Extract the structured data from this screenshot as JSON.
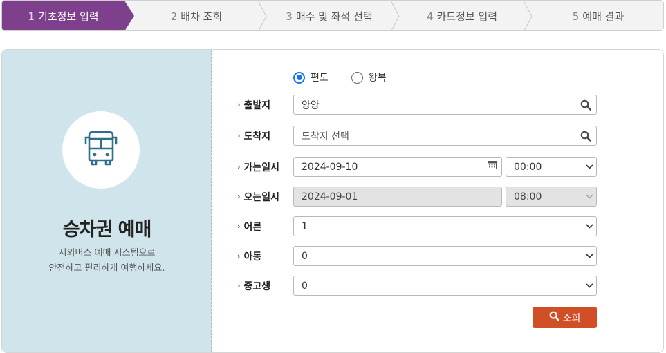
{
  "steps": [
    {
      "num": "1",
      "label": "기초정보 입력",
      "active": true
    },
    {
      "num": "2",
      "label": "배차 조회"
    },
    {
      "num": "3",
      "label": "매수 및 좌석 선택"
    },
    {
      "num": "4",
      "label": "카드정보 입력"
    },
    {
      "num": "5",
      "label": "예매 결과"
    }
  ],
  "sidebar": {
    "icon": "bus-icon",
    "title": "승차권 예매",
    "desc_line1": "시외버스 예매 시스템으로",
    "desc_line2": "안전하고 편리하게 여행하세요."
  },
  "trip_type": {
    "one_way": "편도",
    "round_trip": "왕복",
    "selected": "one_way"
  },
  "form": {
    "departure": {
      "label": "출발지",
      "value": "양양"
    },
    "arrival": {
      "label": "도착지",
      "placeholder": "도착지 선택"
    },
    "depart_date": {
      "label": "가는일시",
      "date": "2024-09-10",
      "time": "00:00"
    },
    "return_date": {
      "label": "오는일시",
      "date": "2024-09-01",
      "time": "08:00"
    },
    "adult": {
      "label": "어른",
      "value": "1"
    },
    "child": {
      "label": "아동",
      "value": "0"
    },
    "student": {
      "label": "중고생",
      "value": "0"
    }
  },
  "search_button": "조회",
  "colors": {
    "active_step": "#7e3f8d",
    "sidebar_bg": "#cfe4eb",
    "accent": "#d14f27",
    "label_marker": "#c2371b",
    "icon_color": "#2e6f8a"
  }
}
